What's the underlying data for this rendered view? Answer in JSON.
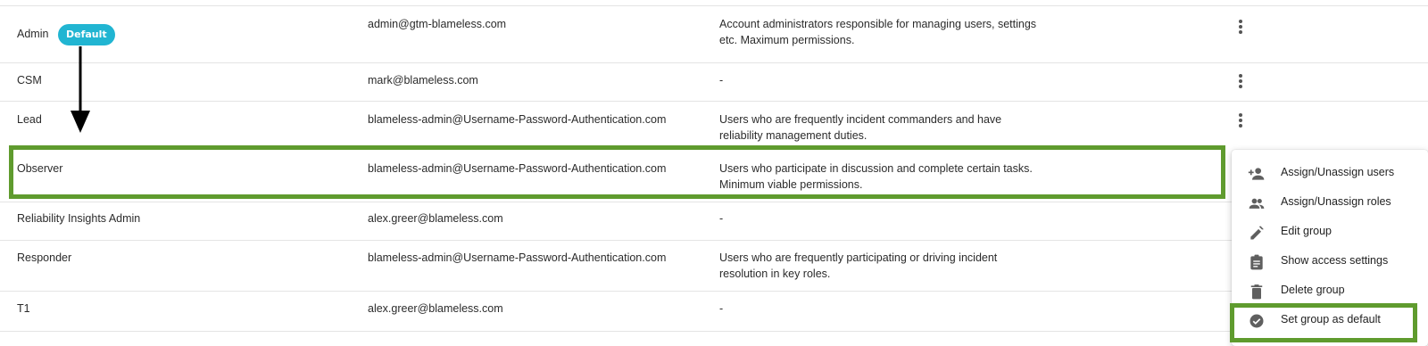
{
  "rows": [
    {
      "name": "Admin",
      "badge": "Default",
      "email": "admin@gtm-blameless.com",
      "desc1": "Account administrators responsible for managing users, settings",
      "desc2": "etc. Maximum permissions."
    },
    {
      "name": "CSM",
      "email": "mark@blameless.com",
      "desc1": "-",
      "desc2": ""
    },
    {
      "name": "Lead",
      "email": "blameless-admin@Username-Password-Authentication.com",
      "desc1": "Users who are frequently incident commanders and have",
      "desc2": "reliability management duties."
    },
    {
      "name": "Observer",
      "email": "blameless-admin@Username-Password-Authentication.com",
      "desc1": "Users who participate in discussion and complete certain tasks.",
      "desc2": "Minimum viable permissions."
    },
    {
      "name": "Reliability Insights Admin",
      "email": "alex.greer@blameless.com",
      "desc1": "-",
      "desc2": ""
    },
    {
      "name": "Responder",
      "email": "blameless-admin@Username-Password-Authentication.com",
      "desc1": "Users who are frequently participating or driving incident",
      "desc2": "resolution in key roles."
    },
    {
      "name": "T1",
      "email": "alex.greer@blameless.com",
      "desc1": "-",
      "desc2": ""
    }
  ],
  "menu": {
    "items": [
      {
        "label": "Assign/Unassign users",
        "icon": "person-add-icon"
      },
      {
        "label": "Assign/Unassign roles",
        "icon": "group-icon"
      },
      {
        "label": "Edit group",
        "icon": "pencil-icon"
      },
      {
        "label": "Show access settings",
        "icon": "clipboard-icon"
      },
      {
        "label": "Delete group",
        "icon": "trash-icon"
      },
      {
        "label": "Set group as default",
        "icon": "check-circle-icon"
      }
    ]
  },
  "colors": {
    "badge": "#21b5d2",
    "highlight": "#5f9b2e"
  }
}
